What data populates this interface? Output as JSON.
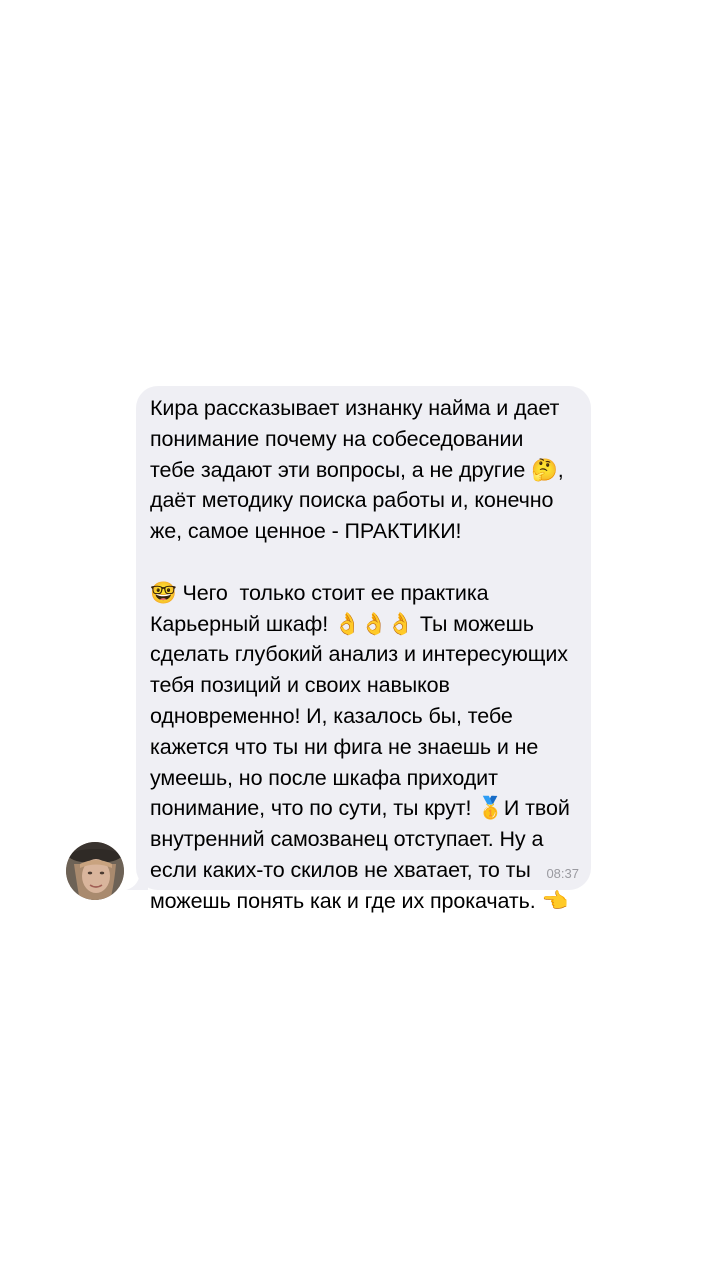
{
  "chat": {
    "message": {
      "text": "Кира рассказывает изнанку найма и дает понимание почему на собеседовании тебе задают эти вопросы, а не другие 🤔, даёт методику поиска работы и, конечно же, самое ценное - ПРАКТИКИ!\n\n🤓 Чего  только стоит ее практика Карьерный шкаф! 👌👌👌 Ты можешь сделать глубокий анализ и интересующих тебя позиций и своих навыков одновременно! И, казалось бы, тебе кажется что ты ни фига не знаешь и не умеешь, но после шкафа приходит понимание, что по сути, ты крут! 🥇И твой внутренний самозванец отступает. Ну а если каких-то скилов не хватает, то ты можешь понять как и где их прокачать. 👈",
      "time": "08:37"
    },
    "colors": {
      "bubble": "#efeff4",
      "time": "#9a9aa0",
      "background": "#ffffff"
    }
  }
}
